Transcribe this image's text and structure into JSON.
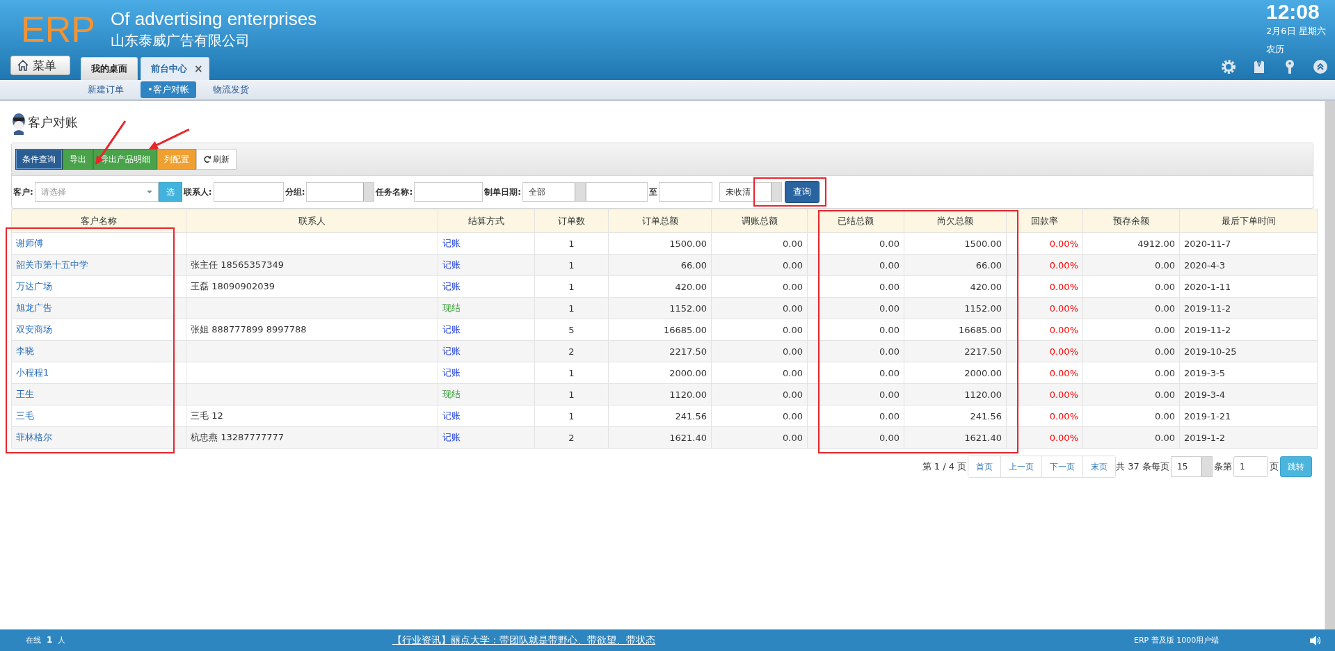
{
  "header": {
    "logo": "ERP",
    "title": "Of advertising enterprises",
    "company": "山东泰威广告有限公司",
    "clock": {
      "time": "12:08",
      "date": "2月6日 星期六",
      "lunar": "农历"
    }
  },
  "menu_button": "菜单",
  "tabs": [
    {
      "label": "我的桌面",
      "selected": false
    },
    {
      "label": "前台中心",
      "selected": true,
      "close": "×"
    }
  ],
  "subnav": [
    {
      "label": "新建订单",
      "selected": false
    },
    {
      "label": "•客户对帐",
      "selected": true
    },
    {
      "label": "物流发货",
      "selected": false
    }
  ],
  "page_title": "客户对账",
  "toolbar": [
    {
      "label": "条件查询",
      "kind": "primary"
    },
    {
      "label": "导出",
      "kind": "success"
    },
    {
      "label": "导出产品明细",
      "kind": "success"
    },
    {
      "label": "列配置",
      "kind": "warning"
    },
    {
      "label": "刷新",
      "kind": "refresh"
    }
  ],
  "filters": [
    {
      "kind": "label",
      "text": "客户:"
    },
    {
      "kind": "combo",
      "placeholder": "请选择"
    },
    {
      "kind": "pick",
      "text": "选"
    },
    {
      "kind": "label",
      "text": "联系人:"
    },
    {
      "kind": "input"
    },
    {
      "kind": "label",
      "text": "分组:"
    },
    {
      "kind": "select"
    },
    {
      "kind": "label",
      "text": "任务名称:"
    },
    {
      "kind": "input"
    },
    {
      "kind": "label",
      "text": "制单日期:"
    },
    {
      "kind": "select",
      "value": "全部"
    },
    {
      "kind": "input"
    },
    {
      "kind": "label",
      "text": "至"
    },
    {
      "kind": "input"
    },
    {
      "kind": "select",
      "value": "未收清"
    },
    {
      "kind": "button",
      "text": "查询"
    }
  ],
  "table": {
    "columns": [
      "客户名称",
      "联系人",
      "结算方式",
      "订单数",
      "订单总额",
      "调账总额",
      "已结总额",
      "尚欠总额",
      "回款率",
      "预存余额",
      "最后下单时间"
    ],
    "rows": [
      {
        "customer": "谢师傅",
        "settlement": {
          "text": "记账",
          "color": "#1f3fe0"
        },
        "orders": "1",
        "total": "1500.00",
        "adjusted": "0.00",
        "settled": "0.00",
        "owed": "1500.00",
        "rate": "0.00%",
        "prepaid": "4912.00",
        "last_order": "2020-11-7"
      },
      {
        "customer": "韶关市第十五中学",
        "contact": "张主任 18565357349",
        "settlement": {
          "text": "记账",
          "color": "#1f3fe0"
        },
        "orders": "1",
        "total": "66.00",
        "adjusted": "0.00",
        "settled": "0.00",
        "owed": "66.00",
        "rate": "0.00%",
        "prepaid": "0.00",
        "last_order": "2020-4-3"
      },
      {
        "customer": "万达广场",
        "contact": "王磊 18090902039",
        "settlement": {
          "text": "记账",
          "color": "#1f3fe0"
        },
        "orders": "1",
        "total": "420.00",
        "adjusted": "0.00",
        "settled": "0.00",
        "owed": "420.00",
        "rate": "0.00%",
        "prepaid": "0.00",
        "last_order": "2020-1-11"
      },
      {
        "customer": "旭龙广告",
        "settlement": {
          "text": "现结",
          "color": "#2e9a2e"
        },
        "orders": "1",
        "total": "1152.00",
        "adjusted": "0.00",
        "settled": "0.00",
        "owed": "1152.00",
        "rate": "0.00%",
        "prepaid": "0.00",
        "last_order": "2019-11-2"
      },
      {
        "customer": "双安商场",
        "contact": "张姐 888777899 8997788",
        "settlement": {
          "text": "记账",
          "color": "#1f3fe0"
        },
        "orders": "5",
        "total": "16685.00",
        "adjusted": "0.00",
        "settled": "0.00",
        "owed": "16685.00",
        "rate": "0.00%",
        "prepaid": "0.00",
        "last_order": "2019-11-2"
      },
      {
        "customer": "李晓",
        "settlement": {
          "text": "记账",
          "color": "#1f3fe0"
        },
        "orders": "2",
        "total": "2217.50",
        "adjusted": "0.00",
        "settled": "0.00",
        "owed": "2217.50",
        "rate": "0.00%",
        "prepaid": "0.00",
        "last_order": "2019-10-25"
      },
      {
        "customer": "小程程1",
        "settlement": {
          "text": "记账",
          "color": "#1f3fe0"
        },
        "orders": "1",
        "total": "2000.00",
        "adjusted": "0.00",
        "settled": "0.00",
        "owed": "2000.00",
        "rate": "0.00%",
        "prepaid": "0.00",
        "last_order": "2019-3-5"
      },
      {
        "customer": "王生",
        "settlement": {
          "text": "现结",
          "color": "#2e9a2e"
        },
        "orders": "1",
        "total": "1120.00",
        "adjusted": "0.00",
        "settled": "0.00",
        "owed": "1120.00",
        "rate": "0.00%",
        "prepaid": "0.00",
        "last_order": "2019-3-4"
      },
      {
        "customer": "三毛",
        "contact": "三毛 12",
        "settlement": {
          "text": "记账",
          "color": "#1f3fe0"
        },
        "orders": "1",
        "total": "241.56",
        "adjusted": "0.00",
        "settled": "0.00",
        "owed": "241.56",
        "rate": "0.00%",
        "prepaid": "0.00",
        "last_order": "2019-1-21"
      },
      {
        "customer": "菲林格尔",
        "contact": "杭忠燕 13287777777",
        "settlement": {
          "text": "记账",
          "color": "#1f3fe0"
        },
        "orders": "2",
        "total": "1621.40",
        "adjusted": "0.00",
        "settled": "0.00",
        "owed": "1621.40",
        "rate": "0.00%",
        "prepaid": "0.00",
        "last_order": "2019-1-2"
      }
    ]
  },
  "pagination": {
    "page_info": "第 1 / 4 页",
    "buttons": [
      "首页",
      "上一页",
      "下一页",
      "末页"
    ],
    "total": "共 37 条每页",
    "page_size": "15",
    "page_label": "条第",
    "page": "1",
    "page_suffix": "页",
    "go": "跳转"
  },
  "footer": {
    "online_label": "在线",
    "online_count": "1",
    "online_unit": "人",
    "news": "【行业资讯】丽点大学：带团队就是带野心、带欲望、带状态",
    "edition": "ERP 普及版 1000用户端"
  }
}
